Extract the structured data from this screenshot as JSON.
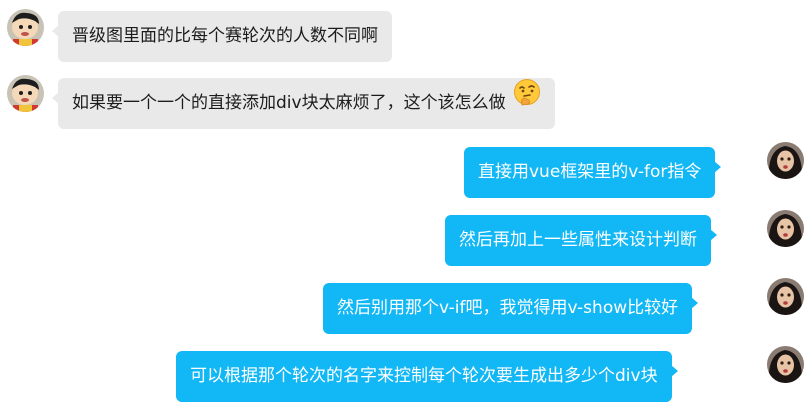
{
  "chat": {
    "messages": [
      {
        "side": "left",
        "text": "晋级图里面的比每个赛轮次的人数不同啊"
      },
      {
        "side": "left",
        "text": "如果要一个一个的直接添加div块太麻烦了，这个该怎么做",
        "emoji": "thinking-face-icon"
      },
      {
        "side": "right",
        "text": "直接用vue框架里的v-for指令"
      },
      {
        "side": "right",
        "text": "然后再加上一些属性来设计判断"
      },
      {
        "side": "right",
        "text": "然后别用那个v-if吧，我觉得用v-show比较好"
      },
      {
        "side": "right",
        "text": "可以根据那个轮次的名字来控制每个轮次要生成出多少个div块"
      }
    ]
  },
  "colors": {
    "incoming_bubble": "#e9e9e9",
    "outgoing_bubble": "#12b7f5",
    "outgoing_text": "#ffffff"
  }
}
